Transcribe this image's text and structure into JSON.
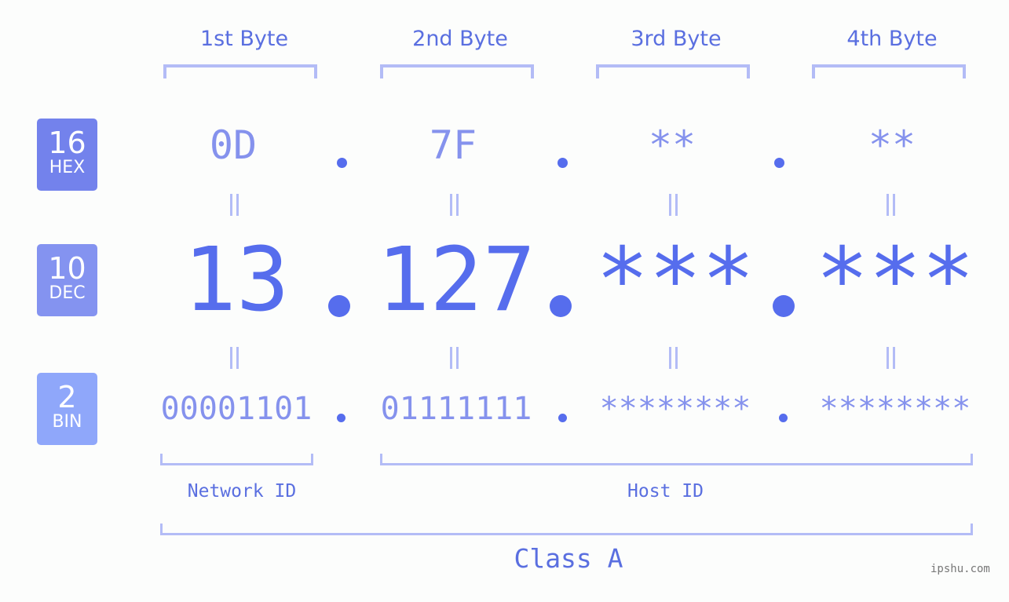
{
  "byte_headers": [
    "1st Byte",
    "2nd Byte",
    "3rd Byte",
    "4th Byte"
  ],
  "badges": [
    {
      "number": "16",
      "label": "HEX",
      "color": "#7382ec"
    },
    {
      "number": "10",
      "label": "DEC",
      "color": "#8493f0"
    },
    {
      "number": "2",
      "label": "BIN",
      "color": "#8fa7fa"
    }
  ],
  "hex": [
    "0D",
    "7F",
    "**",
    "**"
  ],
  "dec": [
    "13",
    "127",
    "***",
    "***"
  ],
  "bin": [
    "00001101",
    "01111111",
    "********",
    "********"
  ],
  "labels": {
    "network_id": "Network ID",
    "host_id": "Host ID",
    "class": "Class A"
  },
  "watermark": "ipshu.com",
  "colors": {
    "accent": "#566ded",
    "light_accent": "#8592ed",
    "bracket": "#b3bcf6"
  }
}
